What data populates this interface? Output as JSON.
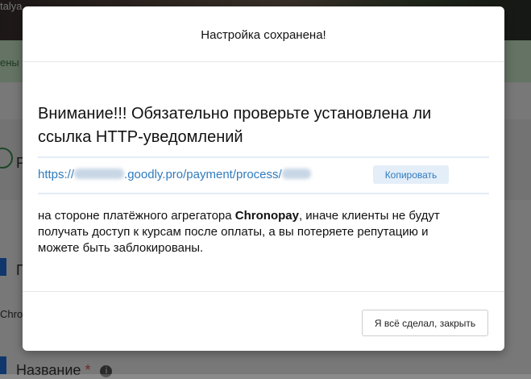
{
  "background": {
    "topbar_text": "talya",
    "alert_text": "ены",
    "section_letter": "Р",
    "section_letter_2": "П",
    "field_partial": "Chro",
    "name_label": "Название",
    "required_mark": "*",
    "info_icon_glyph": "i"
  },
  "modal": {
    "title": "Настройка сохранена!",
    "warning": "Внимание!!! Обязательно проверьте установлена ли ссылка HTTP-уведомлений",
    "url": {
      "prefix": "https://",
      "middle": ".goodly.pro/payment/process/",
      "copy_label": "Копировать"
    },
    "message": {
      "before": "на стороне платёжного агрегатора ",
      "highlight": "Chronopay",
      "after": ", иначе клиенты не будут получать доступ к курсам после оплаты, а вы потеряете репутацию и можете быть заблокированы."
    },
    "close_label": "Я всё сделал, закрыть"
  }
}
